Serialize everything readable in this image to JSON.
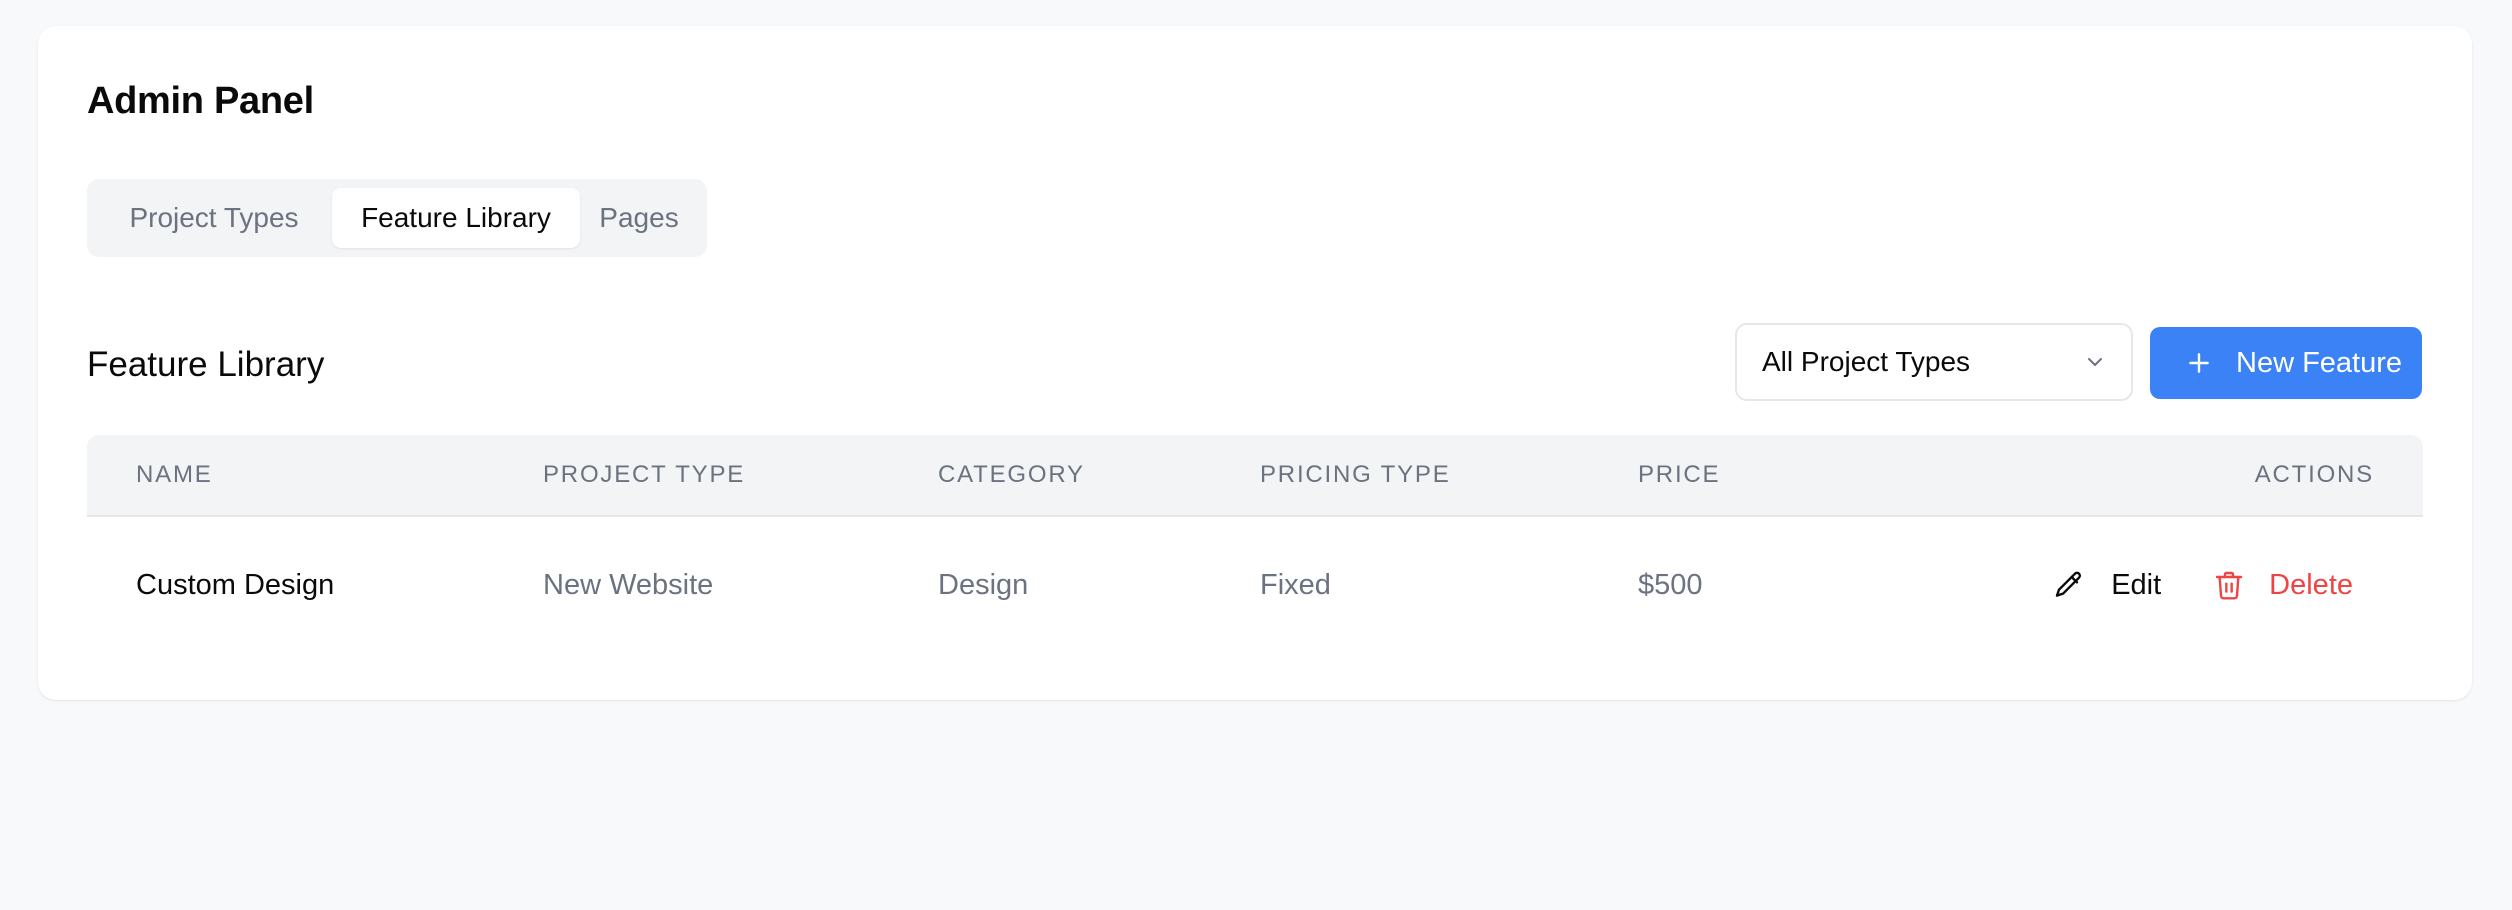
{
  "header": {
    "title": "Admin Panel"
  },
  "tabs": [
    {
      "label": "Project Types",
      "active": false
    },
    {
      "label": "Feature Library",
      "active": true
    },
    {
      "label": "Pages",
      "active": false
    }
  ],
  "section": {
    "title": "Feature Library",
    "filter": {
      "selected": "All Project Types",
      "icon": "chevron-down-icon"
    },
    "new_button": {
      "label": "New Feature",
      "icon": "plus-icon"
    }
  },
  "table": {
    "columns": [
      "Name",
      "Project Type",
      "Category",
      "Pricing Type",
      "Price",
      "Actions"
    ],
    "rows": [
      {
        "name": "Custom Design",
        "project_type": "New Website",
        "category": "Design",
        "pricing_type": "Fixed",
        "price": "$500",
        "actions": {
          "edit_label": "Edit",
          "edit_icon": "pencil-icon",
          "delete_label": "Delete",
          "delete_icon": "trash-icon"
        }
      }
    ]
  },
  "colors": {
    "background": "#f8f9fb",
    "card": "#ffffff",
    "accent": "#3b82f6",
    "danger": "#ef4444",
    "muted_text": "#6b7280",
    "tab_track": "#f3f4f6"
  }
}
